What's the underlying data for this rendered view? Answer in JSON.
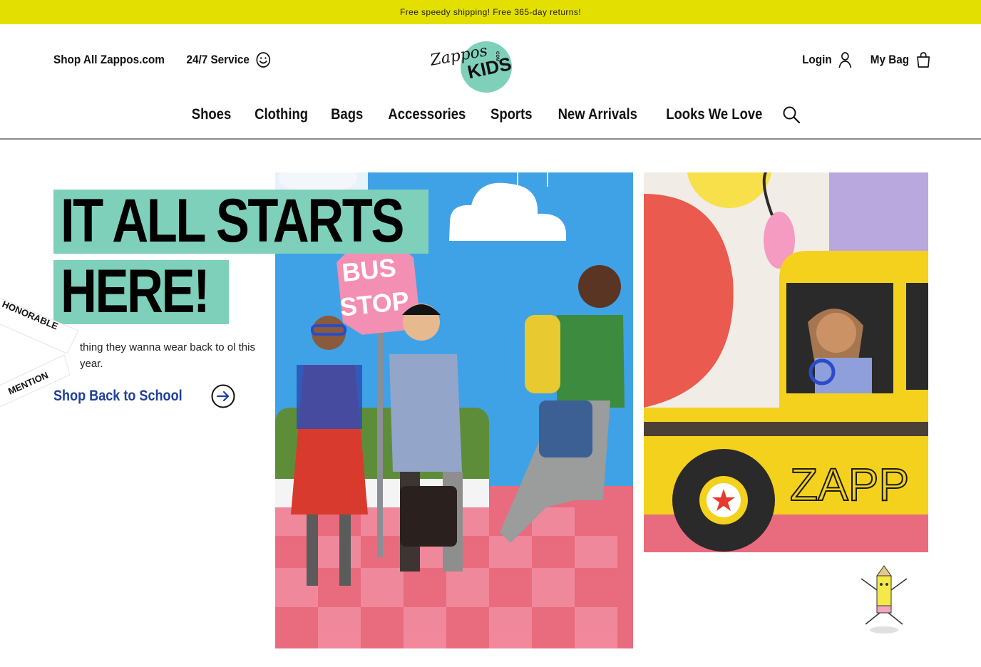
{
  "promo": {
    "text": "Free speedy shipping! Free 365-day returns!"
  },
  "header": {
    "shop_all": "Shop All Zappos.com",
    "service": "24/7 Service",
    "login": "Login",
    "bag": "My Bag",
    "logo": {
      "line1": "Zappos",
      "line2": "KIDS",
      "line1_vertical": "COM"
    }
  },
  "nav": {
    "items": [
      "Shoes",
      "Clothing",
      "Bags",
      "Accessories",
      "Sports",
      "New Arrivals",
      "Looks We Love"
    ]
  },
  "hero": {
    "headline_line1": "IT ALL STARTS",
    "headline_line2": "HERE!",
    "copy": "thing they wanna wear back to ol this year.",
    "cta": "Shop Back to School",
    "ribbon_line1": "HONORABLE",
    "ribbon_line2": "MENTION"
  },
  "photo_main": {
    "sign_line1": "BUS",
    "sign_line2": "STOP"
  },
  "photo_side": {
    "bus_text": "ZAPP"
  },
  "colors": {
    "promo_bg": "#e3df00",
    "accent_teal": "#7fd0bb",
    "cta_blue": "#1f3f9a",
    "sky_blue": "#3fa2e6",
    "floor_pink": "#e96b7e",
    "bus_yellow": "#f4d11c"
  }
}
